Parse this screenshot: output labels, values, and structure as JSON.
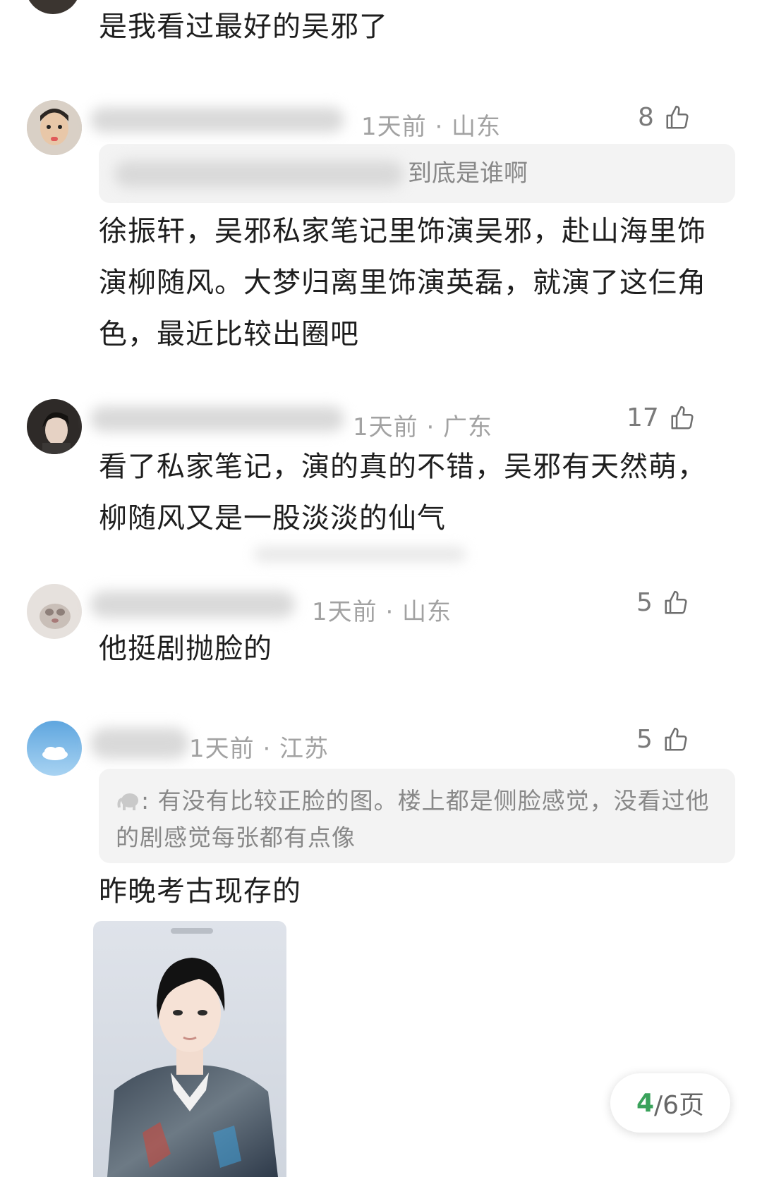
{
  "top_comment": {
    "text": "是我看过最好的吴邪了"
  },
  "comments": [
    {
      "meta": "1天前 · 山东",
      "likes": "8",
      "quote": "到底是谁啊",
      "text": "徐振轩，吴邪私家笔记里饰演吴邪，赴山海里饰演柳随风。大梦归离里饰演英磊，就演了这仨角色，最近比较出圈吧"
    },
    {
      "meta": "1天前 · 广东",
      "likes": "17",
      "text": "看了私家笔记，演的真的不错，吴邪有天然萌，柳随风又是一股淡淡的仙气"
    },
    {
      "meta": "1天前 · 山东",
      "likes": "5",
      "text": "他挺剧抛脸的"
    },
    {
      "meta": "1天前 · 江苏",
      "likes": "5",
      "quote": "有没有比较正脸的图。楼上都是侧脸感觉，没看过他的剧感觉每张都有点像",
      "text": "昨晚考古现存的"
    }
  ],
  "pager": {
    "current": "4",
    "total": "/6页"
  },
  "icons": [
    "thumb-up-icon",
    "elephant-icon"
  ],
  "colors": {
    "accent": "#3aa25b",
    "meta": "#a2a2a2",
    "quote_bg": "#f3f3f3"
  }
}
